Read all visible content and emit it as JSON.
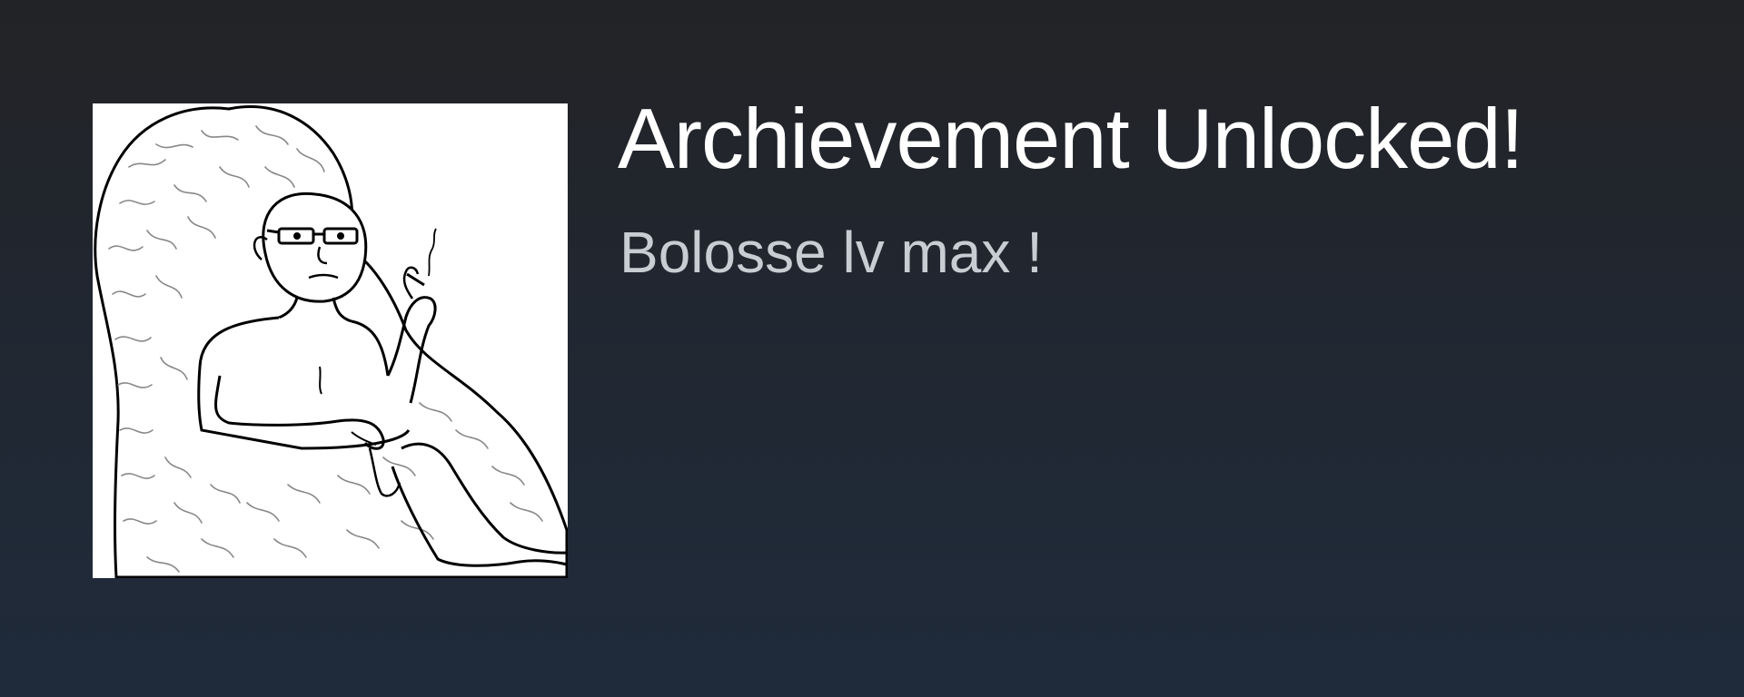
{
  "achievement": {
    "title": "Archievement Unlocked!",
    "description": "Bolosse lv max !",
    "image_icon": "wojak-brain-armchair-icon"
  },
  "colors": {
    "background_top": "#222326",
    "background_bottom": "#1f2b3b",
    "title": "#ffffff",
    "description": "#c8cdd3",
    "image_background": "#ffffff"
  }
}
